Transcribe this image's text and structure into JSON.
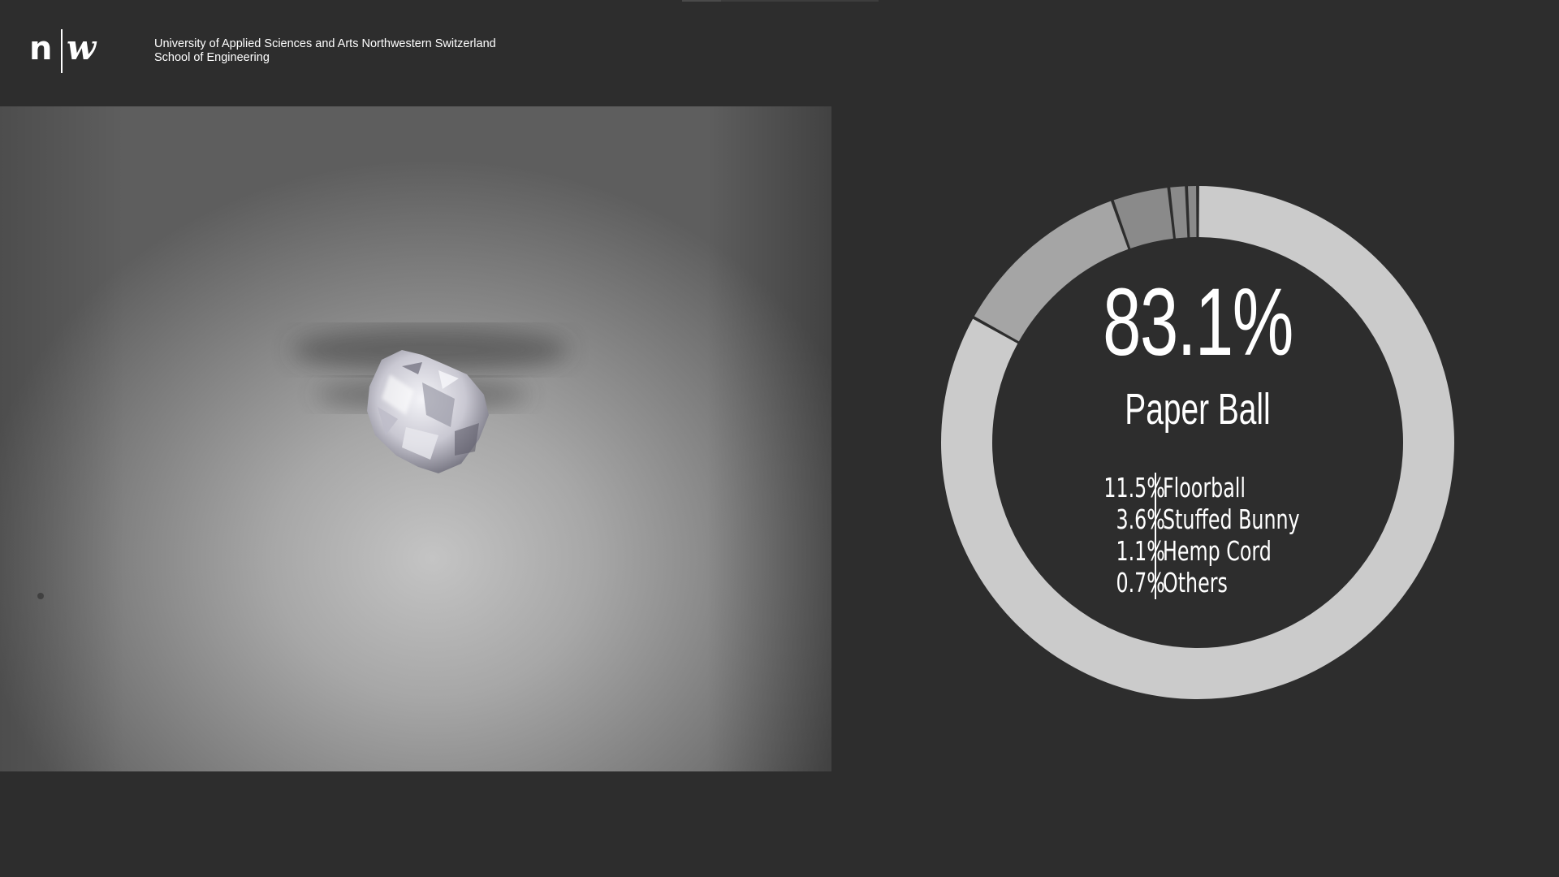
{
  "header": {
    "logo_n": "n",
    "logo_w": "w",
    "institution_line1": "University of Applied Sciences and Arts Northwestern Switzerland",
    "institution_line2": "School of Engineering"
  },
  "camera": {
    "object": "crumpled paper ball"
  },
  "colors": {
    "background": "#2d2d2d",
    "ring_primary": "#cbcbcb",
    "ring_secondary": "#a5a5a5",
    "ring_tertiary": "#8a8a8a",
    "text": "#ffffff"
  },
  "chart_data": {
    "type": "donut",
    "top_class": {
      "label": "Paper Ball",
      "percent_text": "83.1%",
      "value": 83.1
    },
    "others": [
      {
        "label": "Floorball",
        "percent_text": "11.5%",
        "value": 11.5
      },
      {
        "label": "Stuffed Bunny",
        "percent_text": "3.6%",
        "value": 3.6
      },
      {
        "label": "Hemp Cord",
        "percent_text": "1.1%",
        "value": 1.1
      },
      {
        "label": "Others",
        "percent_text": "0.7%",
        "value": 0.7
      }
    ]
  }
}
